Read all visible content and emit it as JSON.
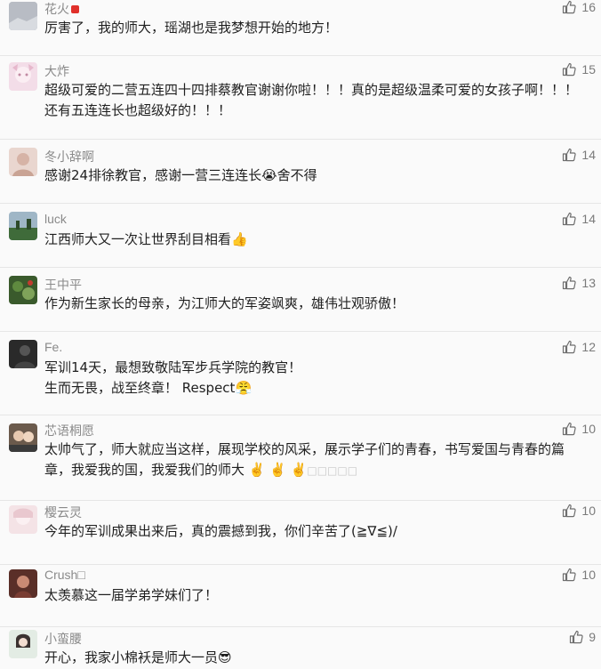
{
  "comments": [
    {
      "name": "花火",
      "text": "厉害了，我的师大，瑶湖也是我梦想开始的地方！",
      "likes": "16"
    },
    {
      "name": "大炸",
      "text": "超级可爱的二营五连四十四排蔡教官谢谢你啦！！！真的是超级温柔可爱的女孩子啊！！！还有五连连长也超级好的！！！",
      "likes": "15"
    },
    {
      "name": "冬小辞啊",
      "text": "感谢24排徐教官，感谢一营三连连长",
      "text_after": "舍不得",
      "likes": "14"
    },
    {
      "name": "luck",
      "text": "江西师大又一次让世界刮目相看",
      "likes": "14"
    },
    {
      "name": "王中平",
      "text": "作为新生家长的母亲，为江师大的军姿飒爽，雄伟壮观骄傲！",
      "likes": "13"
    },
    {
      "name": "Fe.",
      "line1": "军训14天，最想致敬陆军步兵学院的教官！",
      "line2": "生而无畏，战至终章！ Respect",
      "likes": "12"
    },
    {
      "name": "芯语桐愿",
      "text": "太帅气了，师大就应当这样，展现学校的风采，展示学子们的青春，书写爱国与青春的篇章，我爱我的国，我爱我们的师大",
      "text_after": "□□□□□",
      "likes": "10"
    },
    {
      "name": "樱云灵",
      "text": "今年的军训成果出来后，真的震撼到我，你们辛苦了(≧∇≦)/",
      "likes": "10"
    },
    {
      "name": "Crush□",
      "text": "太羡慕这一届学弟学妹们了！",
      "likes": "10"
    },
    {
      "name": "小蛮腰",
      "text": "开心，我家小棉袄是师大一员",
      "likes": "9"
    }
  ],
  "icons": {
    "like": "thumbs-up-icon"
  },
  "colors": {
    "name": "#8a8a8a",
    "text": "#1f1f1f",
    "like": "#7a7a7a",
    "background": "#fafafa"
  }
}
